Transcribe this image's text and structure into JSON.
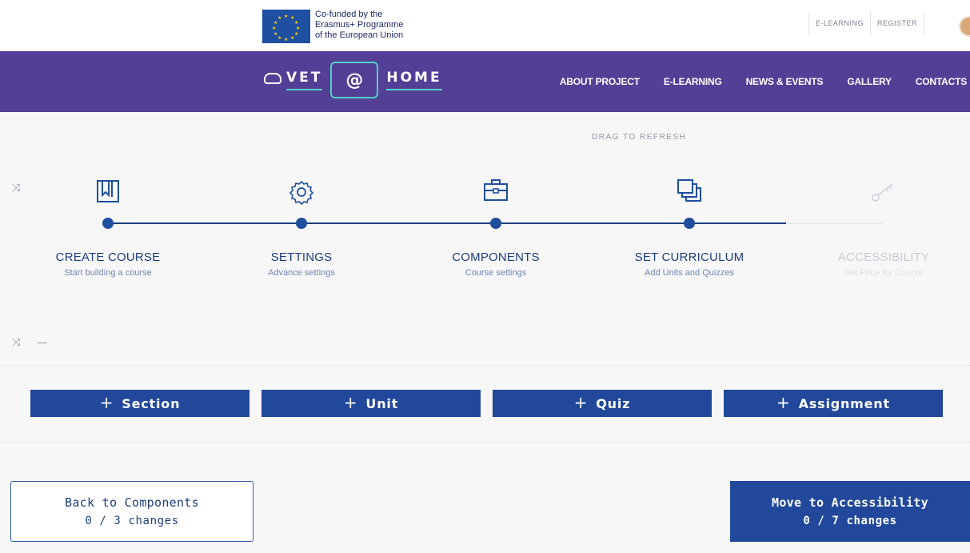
{
  "eu": {
    "line1": "Co-funded by the",
    "line2": "Erasmus+ Programme",
    "line3": "of the European Union"
  },
  "toplinks": [
    "E-LEARNING",
    "REGISTER"
  ],
  "logo": {
    "left": "VET",
    "at": "@",
    "right": "HOME"
  },
  "nav": [
    "ABOUT PROJECT",
    "E-LEARNING",
    "NEWS & EVENTS",
    "GALLERY",
    "CONTACTS"
  ],
  "drag_label": "DRAG TO REFRESH",
  "steps": [
    {
      "title": "CREATE COURSE",
      "subtitle": "Start building a course",
      "icon": "bookmark-icon"
    },
    {
      "title": "SETTINGS",
      "subtitle": "Advance settings",
      "icon": "gear-icon"
    },
    {
      "title": "COMPONENTS",
      "subtitle": "Course settings",
      "icon": "briefcase-icon"
    },
    {
      "title": "SET CURRICULUM",
      "subtitle": "Add Units and Quizzes",
      "icon": "stack-icon"
    },
    {
      "title": "ACCESSIBILITY",
      "subtitle": "Set Price for Course",
      "icon": "key-icon"
    }
  ],
  "shuffle_glyph": "⤨",
  "dash_glyph": "—",
  "add_buttons": [
    {
      "plus": "+",
      "label": "Section"
    },
    {
      "plus": "+",
      "label": "Unit"
    },
    {
      "plus": "+",
      "label": "Quiz"
    },
    {
      "plus": "+",
      "label": "Assignment"
    }
  ],
  "back_button": {
    "label": "Back to Components",
    "changes": "0 / 3 changes"
  },
  "forward_button": {
    "label": "Move to Accessibility",
    "changes": "0 / 7 changes"
  },
  "colors": {
    "nav_bg": "#533f96",
    "accent_teal": "#4fd1c5",
    "primary_blue": "#21489a",
    "text_blue": "#1c3f7a"
  }
}
